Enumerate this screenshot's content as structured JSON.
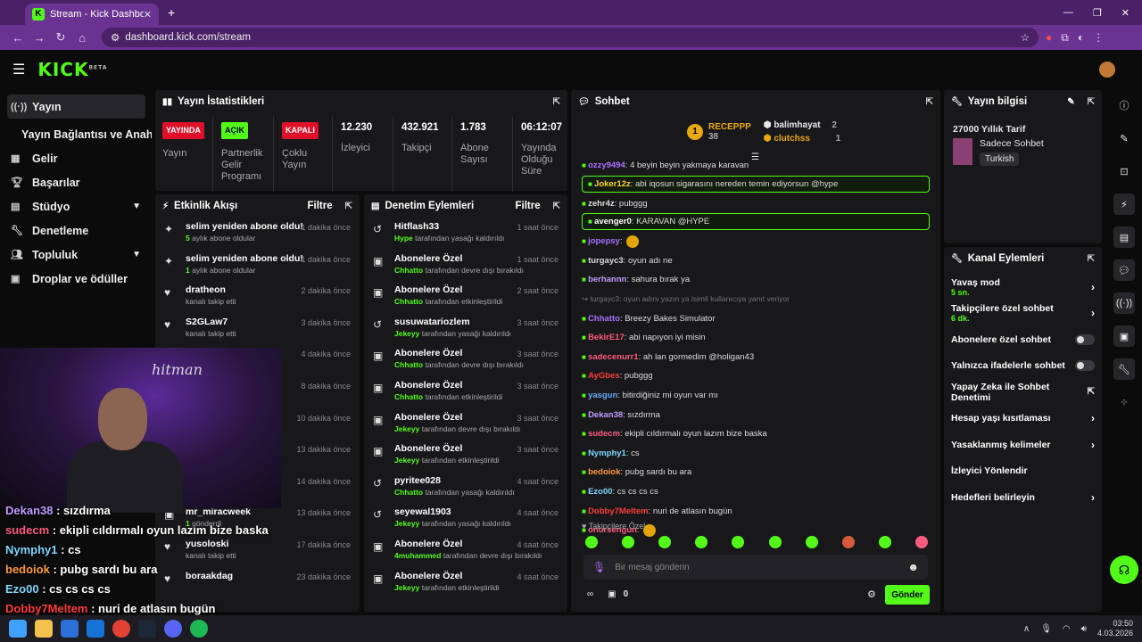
{
  "browser": {
    "tab_title": "Stream - Kick Dashboard",
    "url": "dashboard.kick.com/stream"
  },
  "app": {
    "logo": "KICK",
    "logo_tag": "BETA"
  },
  "sidebar": {
    "items": [
      {
        "label": "Yayın",
        "icon": "radio-icon"
      },
      {
        "label": "Yayın Bağlantısı ve Anahtarı",
        "icon": ""
      },
      {
        "label": "Gelir",
        "icon": "chart-icon"
      },
      {
        "label": "Başarılar",
        "icon": "trophy-icon"
      },
      {
        "label": "Stüdyo",
        "icon": "grid-icon"
      },
      {
        "label": "Denetleme",
        "icon": "wrench-icon"
      },
      {
        "label": "Topluluk",
        "icon": "people-icon"
      },
      {
        "label": "Droplar ve ödüller",
        "icon": "gift-icon"
      }
    ]
  },
  "stats": {
    "title": "Yayın İstatistikleri",
    "items": [
      {
        "badge": "YAYINDA",
        "label": "Yayın",
        "color": "#e0102a"
      },
      {
        "badge": "AÇIK",
        "label": "Partnerlik Gelir Programı",
        "color": "#53fc18"
      },
      {
        "badge": "KAPALI",
        "label": "Çoklu Yayın",
        "color": "#e0102a"
      },
      {
        "value": "12.230",
        "label": "İzleyici"
      },
      {
        "value": "432.921",
        "label": "Takipçi"
      },
      {
        "value": "1.783",
        "label": "Abone Sayısı"
      },
      {
        "value": "06:12:07",
        "label": "Yayında Olduğu Süre"
      }
    ]
  },
  "activity": {
    "title": "Etkinlik Akışı",
    "filter": "Filtre",
    "rows": [
      {
        "title": "selim yeniden abone oldu!",
        "sub_b": "5",
        "sub": " aylık abone oldular",
        "time": "1 dakika önce",
        "icon": "star-icon"
      },
      {
        "title": "selim yeniden abone oldu!",
        "sub_b": "1",
        "sub": " aylık abone oldular",
        "time": "1 dakika önce",
        "icon": "star-icon"
      },
      {
        "title": "dratheon",
        "sub_b": "",
        "sub": "kanalı takip etti",
        "time": "2 dakika önce",
        "icon": "heart-icon"
      },
      {
        "title": "S2GLaw7",
        "sub_b": "",
        "sub": "kanalı takip etti",
        "time": "3 dakika önce",
        "icon": "heart-icon"
      },
      {
        "title": "",
        "sub_b": "",
        "sub": "",
        "time": "4 dakika önce",
        "icon": ""
      },
      {
        "title": "",
        "sub_b": "",
        "sub": "",
        "time": "8 dakika önce",
        "icon": ""
      },
      {
        "title": "",
        "sub_b": "",
        "sub": "",
        "time": "10 dakika önce",
        "icon": ""
      },
      {
        "title": "",
        "sub_b": "",
        "sub": "",
        "time": "13 dakika önce",
        "icon": ""
      },
      {
        "title": "",
        "sub_b": "",
        "sub": "",
        "time": "14 dakika önce",
        "icon": ""
      },
      {
        "title": "mr_miracweek",
        "sub_b": "1",
        "sub": " gönderdi",
        "time": "13 dakika önce",
        "icon": "gift-icon"
      },
      {
        "title": "yusoloski",
        "sub_b": "",
        "sub": "kanalı takip etti",
        "time": "17 dakika önce",
        "icon": "heart-icon"
      },
      {
        "title": "boraakdag",
        "sub_b": "",
        "sub": "",
        "time": "23 dakika önce",
        "icon": "heart-icon"
      }
    ]
  },
  "moderation": {
    "title": "Denetim Eylemleri",
    "filter": "Filtre",
    "rows": [
      {
        "title": "Hitflash33",
        "actor": "Hype",
        "action": " tarafından yasağı kaldırıldı",
        "time": "1 saat önce",
        "icon": "undo-icon"
      },
      {
        "title": "Abonelere Özel",
        "actor": "Chhatto",
        "action": " tarafından devre dışı bırakıldı",
        "time": "1 saat önce",
        "icon": "gift-icon"
      },
      {
        "title": "Abonelere Özel",
        "actor": "Chhatto",
        "action": " tarafından etkinleştirildi",
        "time": "2 saat önce",
        "icon": "gift-icon"
      },
      {
        "title": "susuwatariozlem",
        "actor": "Jekeyy",
        "action": " tarafından yasağı kaldırıldı",
        "time": "3 saat önce",
        "icon": "undo-icon"
      },
      {
        "title": "Abonelere Özel",
        "actor": "Chhatto",
        "action": " tarafından devre dışı bırakıldı",
        "time": "3 saat önce",
        "icon": "gift-icon"
      },
      {
        "title": "Abonelere Özel",
        "actor": "Chhatto",
        "action": " tarafından etkinleştirildi",
        "time": "3 saat önce",
        "icon": "gift-icon"
      },
      {
        "title": "Abonelere Özel",
        "actor": "Jekeyy",
        "action": " tarafından devre dışı bırakıldı",
        "time": "3 saat önce",
        "icon": "gift-icon"
      },
      {
        "title": "Abonelere Özel",
        "actor": "Jekeyy",
        "action": " tarafından etkinleştirildi",
        "time": "3 saat önce",
        "icon": "gift-icon"
      },
      {
        "title": "pyritee028",
        "actor": "Chhatto",
        "action": " tarafından yasağı kaldırıldı",
        "time": "4 saat önce",
        "icon": "undo-icon"
      },
      {
        "title": "seyewal1903",
        "actor": "Jekeyy",
        "action": " tarafından yasağı kaldırıldı",
        "time": "4 saat önce",
        "icon": "undo-icon"
      },
      {
        "title": "Abonelere Özel",
        "actor": "4muhammed",
        "action": " tarafından devre dışı bırakıldı",
        "time": "4 saat önce",
        "icon": "gift-icon"
      },
      {
        "title": "Abonelere Özel",
        "actor": "Jekeyy",
        "action": " tarafından etkinleştirildi",
        "time": "4 saat önce",
        "icon": "gift-icon"
      }
    ]
  },
  "chat": {
    "title": "Sohbet",
    "top": {
      "first": "RECEPPP",
      "first_count": "38",
      "second": "balimhayat",
      "second_count": "2",
      "third": "clutchss",
      "third_count": "1"
    },
    "lines": [
      {
        "user": "ozzy9494",
        "msg": ": 4 beyin beyin yakmaya karavan",
        "color": "#a970ff",
        "hl": false
      },
      {
        "user": "Joker12z",
        "msg": ": abi iqosun sigarasını nereden temin ediyorsun @hype",
        "color": "#ffd42a",
        "hl": true
      },
      {
        "user": "zehr4z",
        "msg": ": pubggg",
        "color": "#dddddd",
        "hl": false
      },
      {
        "user": "avenger0",
        "msg": ": KARAVAN @HYPE",
        "color": "#ffffff",
        "hl": true
      },
      {
        "user": "jopepsy",
        "msg": ":",
        "color": "#a970ff",
        "hl": false
      },
      {
        "user": "turgayc3",
        "msg": ": oyun adı ne",
        "color": "#dddddd",
        "hl": false
      },
      {
        "user": "berhannn",
        "msg": ": sahura bırak ya",
        "color": "#c09bff",
        "hl": false
      },
      {
        "user": "↪ turgayc3: oyun adını yazın ya isimli kullanıcıya yanıt veriyor",
        "msg": "",
        "color": "#777777",
        "hl": false
      },
      {
        "user": "Chhatto",
        "msg": ": Breezy Bakes Simulator",
        "color": "#a970ff",
        "hl": false
      },
      {
        "user": "BekirE17",
        "msg": ": abi napıyon iyi misin",
        "color": "#ff5b7d",
        "hl": false
      },
      {
        "user": "sadecenurr1",
        "msg": ": ah lan gormedim @holigan43",
        "color": "#ff5b7d",
        "hl": false
      },
      {
        "user": "AyGbes",
        "msg": ": pubggg",
        "color": "#ff3b3b",
        "hl": false
      },
      {
        "user": "yasgun",
        "msg": ": bitirdiğiniz mi oyun var mı",
        "color": "#6aa9ff",
        "hl": false
      },
      {
        "user": "Dekan38",
        "msg": ": sızdırma",
        "color": "#c09bff",
        "hl": false
      },
      {
        "user": "sudecm",
        "msg": ": ekipli cıldırmalı oyun lazım bize baska",
        "color": "#ff5b7d",
        "hl": false
      },
      {
        "user": "Nymphy1",
        "msg": ": cs",
        "color": "#7fd6ff",
        "hl": false
      },
      {
        "user": "bedoiok",
        "msg": ": pubg sardı bu ara",
        "color": "#ff9a3b",
        "hl": false
      },
      {
        "user": "Ezo00",
        "msg": ": cs cs cs cs",
        "color": "#7fd6ff",
        "hl": false
      },
      {
        "user": "Dobby7Meltem",
        "msg": ": nuri de atlasın bugün",
        "color": "#ff3b3b",
        "hl": false
      },
      {
        "user": "onursengun",
        "msg": ":",
        "color": "#ff5b7d",
        "hl": false
      }
    ],
    "followers_label": "Takipçilere Özel",
    "input_placeholder": "Bir mesaj gönderin",
    "count": "0",
    "send": "Gönder"
  },
  "stream_info": {
    "title": "Yayın bilgisi",
    "stream_title": "27000 Yıllık Tarif",
    "category": "Sadece Sohbet",
    "language": "Turkish"
  },
  "channel_actions": {
    "title": "Kanal Eylemleri",
    "items": [
      {
        "label": "Yavaş mod",
        "sub": "5 sn.",
        "ctrl": "chevron"
      },
      {
        "label": "Takipçilere özel sohbet",
        "sub": "6 dk.",
        "ctrl": "chevron"
      },
      {
        "label": "Abonelere özel sohbet",
        "sub": "",
        "ctrl": "toggle"
      },
      {
        "label": "Yalnızca ifadelerle sohbet",
        "sub": "",
        "ctrl": "toggle"
      },
      {
        "label": "Yapay Zeka ile Sohbet Denetimi",
        "sub": "",
        "ctrl": "external"
      },
      {
        "label": "Hesap yaşı kısıtlaması",
        "sub": "",
        "ctrl": "chevron"
      },
      {
        "label": "Yasaklanmış kelimeler",
        "sub": "",
        "ctrl": "chevron"
      },
      {
        "label": "İzleyici Yönlendir",
        "sub": "",
        "ctrl": "none"
      },
      {
        "label": "Hedefleri belirleyin",
        "sub": "",
        "ctrl": "chevron"
      }
    ]
  },
  "overlay_chat": [
    {
      "user": "Dekan38",
      "msg": " : sızdırma",
      "color": "#c09bff"
    },
    {
      "user": "sudecm",
      "msg": " : ekipli cıldırmalı oyun lazım bize baska",
      "color": "#ff5b7d"
    },
    {
      "user": "Nymphy1",
      "msg": " : cs",
      "color": "#7fd6ff"
    },
    {
      "user": "bedoiok",
      "msg": " : pubg sardı bu ara",
      "color": "#ff9a3b"
    },
    {
      "user": "Ezo00",
      "msg": " : cs cs cs cs",
      "color": "#7fd6ff"
    },
    {
      "user": "Dobby7Meltem",
      "msg": " : nuri de atlasın bugün",
      "color": "#ff3b3b"
    }
  ],
  "clock": {
    "time": "03:50",
    "date": "4.03.2026"
  },
  "accent": "#53fc18"
}
